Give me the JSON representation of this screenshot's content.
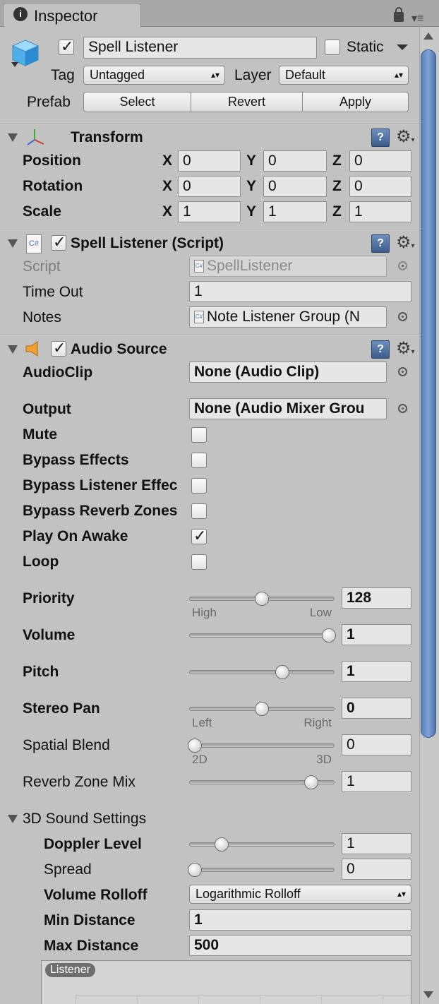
{
  "tab": {
    "title": "Inspector",
    "lock_icon": "lock-icon",
    "menu_icon": "menu-icon"
  },
  "header": {
    "object_name": "Spell Listener",
    "static_label": "Static",
    "static_checked": false,
    "active_checked": true,
    "tag_label": "Tag",
    "tag_value": "Untagged",
    "layer_label": "Layer",
    "layer_value": "Default",
    "prefab_label": "Prefab",
    "prefab_buttons": [
      "Select",
      "Revert",
      "Apply"
    ]
  },
  "transform": {
    "title": "Transform",
    "rows": [
      {
        "label": "Position",
        "x": "0",
        "y": "0",
        "z": "0"
      },
      {
        "label": "Rotation",
        "x": "0",
        "y": "0",
        "z": "0"
      },
      {
        "label": "Scale",
        "x": "1",
        "y": "1",
        "z": "1"
      }
    ],
    "axis_labels": [
      "X",
      "Y",
      "Z"
    ]
  },
  "script_component": {
    "title": "Spell Listener (Script)",
    "enabled": true,
    "script_label": "Script",
    "script_value": "SpellListener",
    "timeout_label": "Time Out",
    "timeout_value": "1",
    "notes_label": "Notes",
    "notes_value": "Note Listener Group (N"
  },
  "audio_source": {
    "title": "Audio Source",
    "enabled": true,
    "audioclip_label": "AudioClip",
    "audioclip_value": "None (Audio Clip)",
    "output_label": "Output",
    "output_value": "None (Audio Mixer Grou",
    "toggles": [
      {
        "label": "Mute",
        "checked": false
      },
      {
        "label": "Bypass Effects",
        "checked": false
      },
      {
        "label": "Bypass Listener Effec",
        "checked": false
      },
      {
        "label": "Bypass Reverb Zones",
        "checked": false
      },
      {
        "label": "Play On Awake",
        "checked": true
      },
      {
        "label": "Loop",
        "checked": false
      }
    ],
    "sliders": [
      {
        "label": "Priority",
        "value": "128",
        "fraction": 0.5,
        "min_label": "High",
        "max_label": "Low",
        "bold": true
      },
      {
        "label": "Volume",
        "value": "1",
        "fraction": 1.0,
        "bold": true
      },
      {
        "label": "Pitch",
        "value": "1",
        "fraction": 0.65,
        "bold": true
      },
      {
        "label": "Stereo Pan",
        "value": "0",
        "fraction": 0.5,
        "min_label": "Left",
        "max_label": "Right",
        "bold": true
      },
      {
        "label": "Spatial Blend",
        "value": "0",
        "fraction": 0.0,
        "min_label": "2D",
        "max_label": "3D",
        "bold": false
      },
      {
        "label": "Reverb Zone Mix",
        "value": "1",
        "fraction": 0.87,
        "bold": false
      }
    ],
    "sound3d": {
      "title": "3D Sound Settings",
      "doppler_label": "Doppler Level",
      "doppler_value": "1",
      "doppler_fraction": 0.2,
      "spread_label": "Spread",
      "spread_value": "0",
      "spread_fraction": 0.0,
      "rolloff_label": "Volume Rolloff",
      "rolloff_value": "Logarithmic Rolloff",
      "min_label": "Min Distance",
      "min_value": "1",
      "max_label": "Max Distance",
      "max_value": "500",
      "graph_badge": "Listener"
    }
  }
}
